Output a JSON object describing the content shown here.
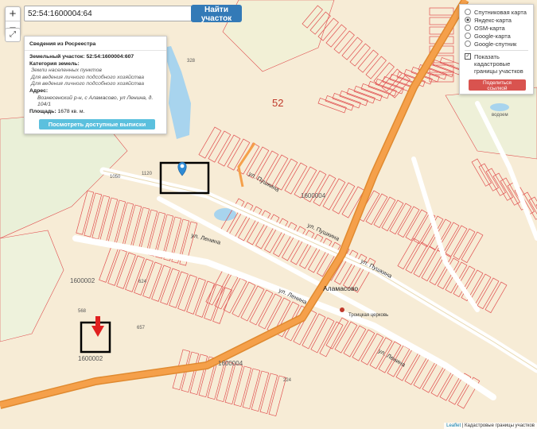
{
  "search": {
    "value": "52:54:1600004:64",
    "button": "Найти участок"
  },
  "zoom": {
    "in": "+",
    "out": "−",
    "fullscreen": "⤢"
  },
  "info": {
    "title": "Сведения из Росреестра",
    "parcel": "Земельный участок: 52:54:1600004:607",
    "category_label": "Категория земель:",
    "category_value": "Земли населенных пунктов",
    "use1": "Для ведения личного подсобного хозяйства",
    "use2": "Для ведения личного подсобного хозяйства",
    "address_label": "Адрес:",
    "address_value": "Вознесенский р-н, с Аламасово, ул Ленина, д. 104/1",
    "area_label": "Площадь:",
    "area_value": "1678 кв. м.",
    "button": "Посмотреть доступные выписки"
  },
  "layers": {
    "options": [
      "Спутниковая карта",
      "Яндекс-карта",
      "OSM-карта",
      "Google-карта",
      "Google-спутник"
    ],
    "selected": "Яндекс-карта",
    "toggle_line1": "Показать",
    "toggle_line2": "кадастровые",
    "toggle_line3": "границы участков",
    "share": "Поделиться ссылкой"
  },
  "map_labels": {
    "road_52": "52",
    "village": "Аламасово",
    "lenina1": "ул. Ленина",
    "lenina2": "ул. Ленина",
    "lenina3": "ул. Ленина",
    "pushkina1": "ул. Пушкина",
    "pushkina2": "ул. Пушкина",
    "pushkina3": "ул. Пушкина",
    "church": "Троицкая церковь",
    "q1600004a": "1600004",
    "q1600004b": "1600004",
    "q1600002a": "1600002",
    "q1600002b": "1600002",
    "p328": "328",
    "p624": "624",
    "p568": "568",
    "p657": "657",
    "p224": "224",
    "p1120": "1120",
    "p1050": "1050",
    "vodoem": "водоем"
  },
  "attribution": {
    "leaflet": "Leaflet",
    "text": "| Кадастровые границы участков"
  },
  "colors": {
    "parcel": "#e05050",
    "road": "#f0a050",
    "water": "#a8d4ee",
    "bg": "#f7ecd6",
    "marker": "#2e8bd6"
  }
}
